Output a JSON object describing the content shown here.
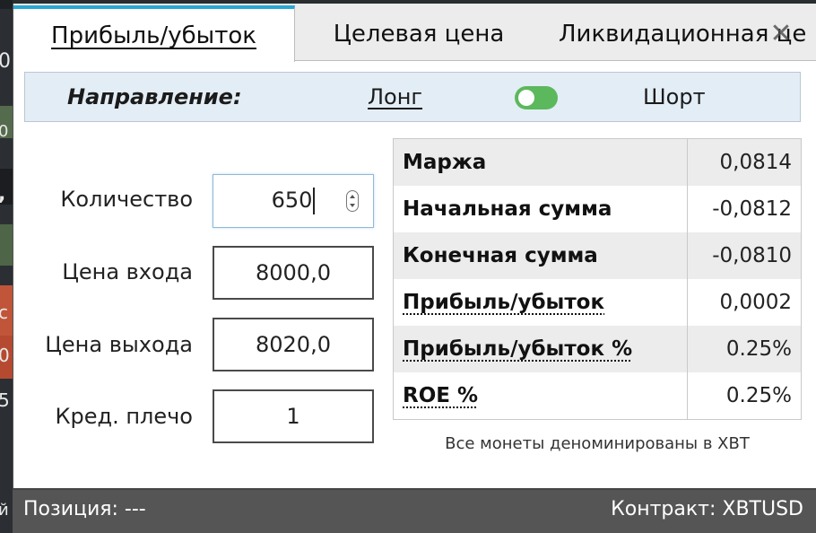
{
  "background_fragments": [
    "0",
    "0",
    ",",
    "c",
    "0",
    "5",
    "й"
  ],
  "tabs": [
    {
      "label": "Прибыль/убыток",
      "active": true
    },
    {
      "label": "Целевая цена",
      "active": false
    },
    {
      "label": "Ликвидационная це",
      "active": false
    }
  ],
  "close_icon": "close-icon",
  "direction": {
    "label": "Направление:",
    "long": "Лонг",
    "short": "Шорт",
    "toggle_color": "#5cb85c"
  },
  "form": {
    "quantity": {
      "label": "Количество",
      "value": "650"
    },
    "entry_price": {
      "label": "Цена входа",
      "value": "8000,0"
    },
    "exit_price": {
      "label": "Цена выхода",
      "value": "8020,0"
    },
    "leverage": {
      "label": "Кред. плечо",
      "value": "1"
    }
  },
  "results": {
    "rows": [
      {
        "name": "Маржа",
        "value": "0,0814"
      },
      {
        "name": "Начальная сумма",
        "value": "-0,0812"
      },
      {
        "name": "Конечная сумма",
        "value": "-0,0810"
      },
      {
        "name": "Прибыль/убыток",
        "value": "0,0002"
      },
      {
        "name": "Прибыль/убыток %",
        "value": "0.25%"
      },
      {
        "name": "ROE %",
        "value": "0.25%"
      }
    ],
    "note": "Все монеты деноминированы в XBT"
  },
  "status": {
    "position": "Позиция: ---",
    "contract": "Контракт: XBTUSD"
  },
  "colors": {
    "tab_accent": "#2aa7d6",
    "direction_bg": "#e3edf6",
    "statusbar_bg": "#555555"
  }
}
